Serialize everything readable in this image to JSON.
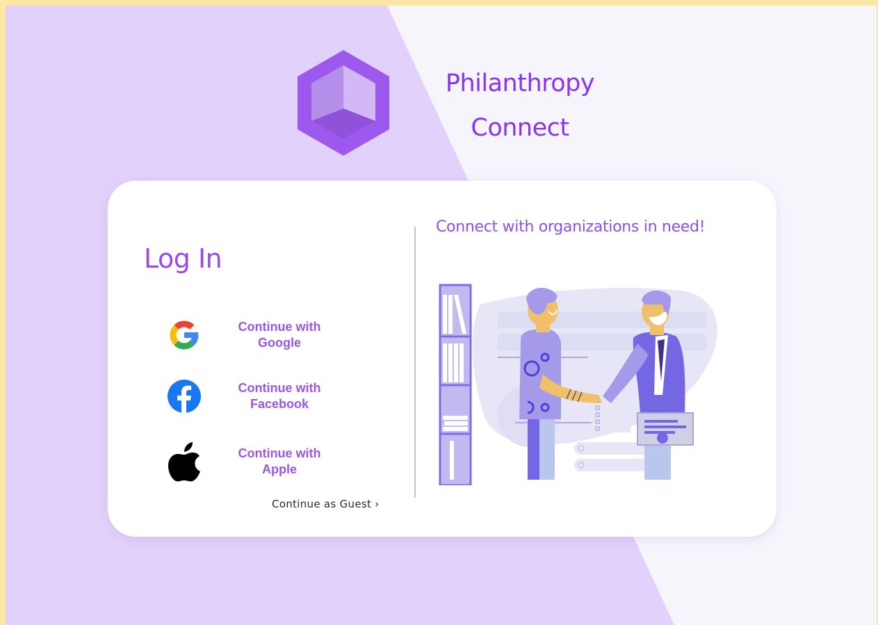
{
  "brand": {
    "line1": "Philanthropy",
    "line2": "Connect"
  },
  "login": {
    "title": "Log In",
    "providers": [
      {
        "name": "google",
        "label_line1": "Continue with",
        "label_line2": "Google"
      },
      {
        "name": "facebook",
        "label_line1": "Continue with",
        "label_line2": "Facebook"
      },
      {
        "name": "apple",
        "label_line1": "Continue with",
        "label_line2": "Apple"
      }
    ],
    "guest": "Continue as Guest ›"
  },
  "promo": {
    "tagline": "Connect with organizations in need!"
  },
  "colors": {
    "accent": "#8a33ee",
    "background_lavender": "#e2d1fb",
    "background_light": "#f6f5fb",
    "border_yellow": "#fde7a4",
    "card": "#ffffff"
  },
  "icons": [
    "app-logo-icon",
    "google-icon",
    "facebook-icon",
    "apple-icon",
    "handshake-illustration"
  ]
}
